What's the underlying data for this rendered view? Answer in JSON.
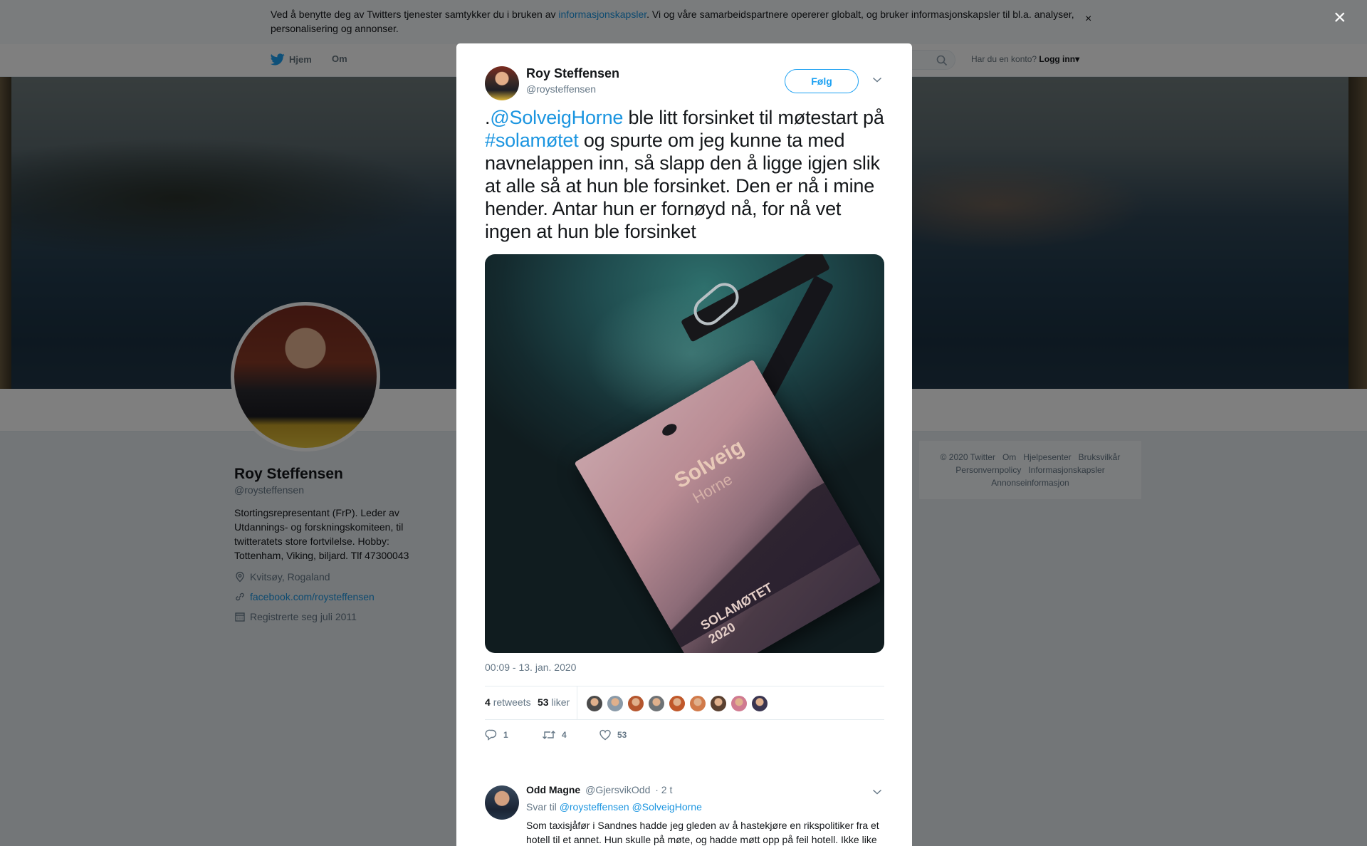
{
  "cookie_bar": {
    "text_before": "Ved å benytte deg av Twitters tjenester samtykker du i bruken av ",
    "link": "informasjonskapsler",
    "text_after": ". Vi og våre samarbeidspartnere opererer globalt, og bruker informasjonskapsler til bl.a. analyser, personalisering og annonser.",
    "close": "×"
  },
  "topnav": {
    "home": "Hjem",
    "about": "Om",
    "login_prompt": "Har du en konto?",
    "login": "Logg inn",
    "login_caret": "▾"
  },
  "profile": {
    "name": "Roy Steffensen",
    "handle": "@roysteffensen",
    "bio": "Stortingsrepresentant (FrP). Leder av Utdannings- og forskningskomiteen, til twitteratets store fortvilelse. Hobby: Tottenham, Viking, biljard. Tlf 47300043",
    "location": "Kvitsøy, Rogaland",
    "url": "facebook.com/roysteffensen",
    "joined": "Registrerte seg juli 2011"
  },
  "footer": {
    "copyright": "© 2020 Twitter",
    "about": "Om",
    "help": "Hjelpesenter",
    "terms": "Bruksvilkår",
    "privacy": "Personvernpolicy",
    "cookies": "Informasjonskapsler",
    "ads": "Annonseinformasjon"
  },
  "overlay_close": "×",
  "tweet": {
    "name": "Roy Steffensen",
    "handle": "@roysteffensen",
    "follow": "Følg",
    "text_dot": ".",
    "mention": "@SolveigHorne",
    "text_1": " ble litt forsinket til møtestart på ",
    "hashtag": "#solamøtet",
    "text_2": " og spurte om jeg kunne ta med navnelappen inn, så slapp den å ligge igjen slik at alle så at hun ble forsinket. Den er nå i mine hender. Antar hun er fornøyd nå, for nå vet ingen at hun ble forsinket",
    "photo": {
      "badge_name": "Solveig",
      "badge_surname": "Horne",
      "badge_event_1": "SOLAMØTET",
      "badge_event_2": "2020"
    },
    "timestamp": "00:09 - 13. jan. 2020",
    "retweets_count": "4",
    "retweets_label": "retweets",
    "likes_count": "53",
    "likes_label": "liker",
    "liker_faces": [
      "#4a4a4a",
      "#8a9aa8",
      "#b5562e",
      "#6e7275",
      "#c0582a",
      "#d17a4a",
      "#5a4030",
      "#d07a90",
      "#3a3550"
    ],
    "reply_count": "1",
    "retweet_count": "4",
    "like_count": "53"
  },
  "reply": {
    "name": "Odd Magne",
    "handle": "@GjersvikOdd",
    "time": "· 2 t",
    "replying_label": "Svar til",
    "replying_to_1": "@roysteffensen",
    "replying_to_2": "@SolveigHorne",
    "text": "Som taxisjåfør i Sandnes hadde jeg gleden av å hastekjøre en rikspolitiker fra et hotell til et annet. Hun skulle på møte, og hadde møtt opp på feil hotell. Ikke like lett alltid.",
    "emoji": "😀"
  },
  "colors": {
    "link": "#1b95e0",
    "twitter_blue": "#1da1f2",
    "muted": "#657786"
  }
}
